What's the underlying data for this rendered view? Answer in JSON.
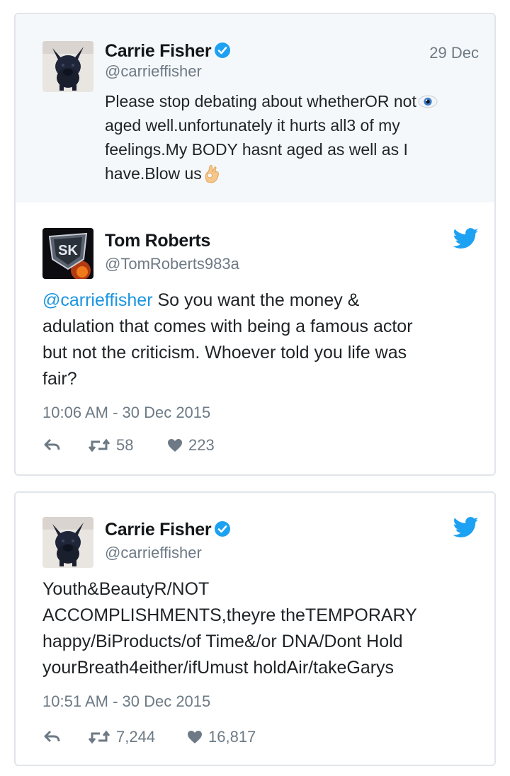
{
  "quoted_tweet": {
    "author_name": "Carrie Fisher",
    "author_handle": "@carrieffisher",
    "date": "29 Dec",
    "lines": [
      "Please stop debating about whetherOR not",
      "aged well.unfortunately it hurts all3 of my",
      "feelings.My BODY hasnt aged as well as I",
      "have.Blow us"
    ]
  },
  "reply_tweet": {
    "author_name": "Tom Roberts",
    "author_handle": "@TomRoberts983a",
    "mention": "@carrieffisher",
    "lines": [
      " So you want the money &",
      "adulation that comes with being a famous actor",
      "but not the criticism. Whoever told you life was",
      "fair?"
    ],
    "timestamp": "10:06 AM - 30 Dec 2015",
    "retweets": "58",
    "likes": "223"
  },
  "response_tweet": {
    "author_name": "Carrie Fisher",
    "author_handle": "@carrieffisher",
    "lines": [
      "Youth&BeautyR/NOT",
      "ACCOMPLISHMENTS,theyre theTEMPORARY",
      "happy/BiProducts/of Time&/or DNA/Dont Hold",
      "yourBreath4either/ifUmust holdAir/takeGarys"
    ],
    "timestamp": "10:51 AM - 30 Dec 2015",
    "retweets": "7,244",
    "likes": "16,817"
  },
  "colors": {
    "link": "#1b95e0",
    "verified": "#1da1f2",
    "meta_gray": "#6d7a85",
    "quoted_bg": "#f5f8fa"
  },
  "icons": [
    "verified-badge-icon",
    "eye-emoji-icon",
    "ok-hand-emoji-icon",
    "twitter-bird-icon",
    "reply-icon",
    "retweet-icon",
    "heart-icon"
  ]
}
